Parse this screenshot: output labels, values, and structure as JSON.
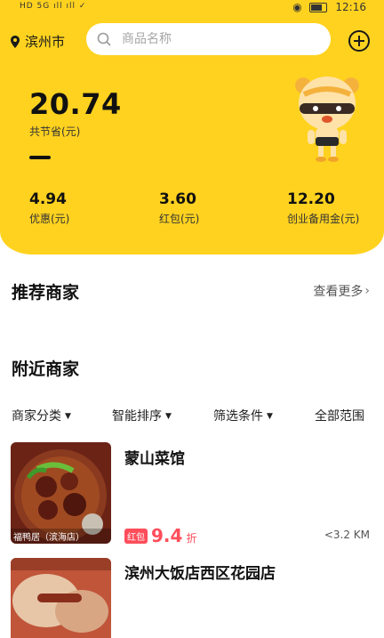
{
  "status_bar": {
    "signal": "HD 5G ıll ıll ✓",
    "time": "12:16"
  },
  "header": {
    "city": "滨州市",
    "search_placeholder": "商品名称"
  },
  "savings": {
    "total_value": "20.74",
    "total_label": "共节省(元)",
    "stats": [
      {
        "value": "4.94",
        "label": "优惠(元)"
      },
      {
        "value": "3.60",
        "label": "红包(元)"
      },
      {
        "value": "12.20",
        "label": "创业备用金(元)"
      }
    ]
  },
  "recommended": {
    "title": "推荐商家",
    "more": "查看更多"
  },
  "nearby": {
    "title": "附近商家",
    "filters": [
      "商家分类",
      "智能排序",
      "筛选条件",
      "全部范围"
    ],
    "shops": [
      {
        "name": "蒙山菜馆",
        "image_caption": "福鸭居（滨海店）",
        "badge": "红包",
        "discount": "9.4",
        "discount_unit": "折",
        "distance": "<3.2 KM"
      },
      {
        "name": "滨州大饭店西区花园店"
      }
    ]
  },
  "colors": {
    "brand_yellow": "#ffd21f",
    "accent_red": "#ff4d5a"
  }
}
